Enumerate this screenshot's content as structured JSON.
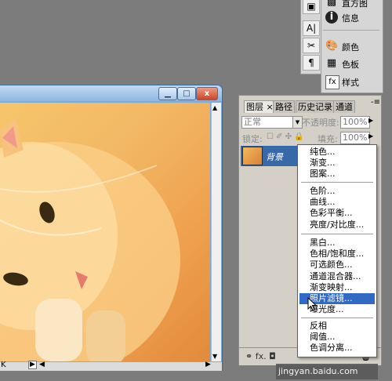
{
  "dock": {
    "items": [
      {
        "label": "直方图",
        "icon": "histogram-icon"
      },
      {
        "label": "信息",
        "icon": "info-icon"
      },
      {
        "label": "颜色",
        "icon": "color-icon"
      },
      {
        "label": "色板",
        "icon": "swatches-icon"
      },
      {
        "label": "样式",
        "icon": "styles-icon"
      }
    ],
    "tools": [
      {
        "label": "A|",
        "icon": "character-icon"
      },
      {
        "label": "✂",
        "icon": "tool-presets-icon"
      },
      {
        "label": "¶",
        "icon": "paragraph-icon"
      }
    ]
  },
  "window": {
    "min": "▁",
    "max": "□",
    "close": "x"
  },
  "status": {
    "zoom_fragment": "K"
  },
  "layers_panel": {
    "tabs": [
      "图层 ×",
      "路径",
      "历史记录",
      "通道"
    ],
    "menu_glyph": "-≡",
    "blend_mode": "正常",
    "opacity_label": "不透明度:",
    "opacity_value": "100%",
    "lock_label": "锁定:",
    "lock_icons": "☐ ✐ ✣ 🔒",
    "fill_label": "填充:",
    "fill_value": "100%",
    "layer_name": "背景",
    "eye": "👁",
    "footer": "⚭ fx. ◘"
  },
  "adjust_menu": {
    "groups": [
      [
        "纯色...",
        "渐变...",
        "图案..."
      ],
      [
        "色阶...",
        "曲线...",
        "色彩平衡...",
        "亮度/对比度..."
      ],
      [
        "黑白...",
        "色相/饱和度...",
        "可选颜色...",
        "通道混合器...",
        "渐变映射...",
        "照片滤镜...",
        "曝光度..."
      ],
      [
        "反相",
        "阈值...",
        "色调分离..."
      ]
    ],
    "highlighted": "照片滤镜..."
  },
  "watermark": {
    "text": "jingyan.baidu.com"
  },
  "colors": {
    "accent": "#316ac5",
    "layer_selected": "#3769a8"
  }
}
